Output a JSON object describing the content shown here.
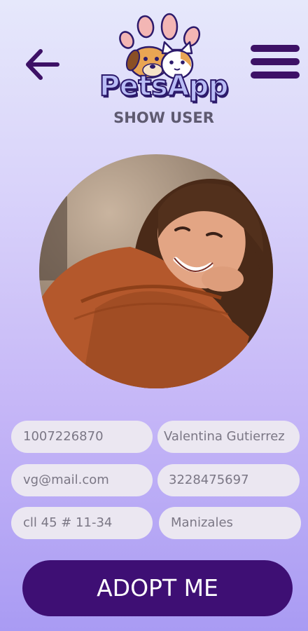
{
  "header": {
    "app_name": "PetsApp",
    "subtitle": "SHOW USER",
    "back_icon": "arrow-left-icon",
    "menu_icon": "hamburger-menu-icon",
    "accent_color": "#3d1166"
  },
  "profile": {
    "photo": "user-avatar-photo"
  },
  "fields": {
    "id_number": "1007226870",
    "full_name": "Valentina Gutierrez",
    "email": "vg@mail.com",
    "phone": "3228475697",
    "address": "cll 45 # 11-34",
    "city": "Manizales"
  },
  "actions": {
    "adopt_label": "ADOPT ME",
    "adopt_color": "#3e0f74"
  }
}
